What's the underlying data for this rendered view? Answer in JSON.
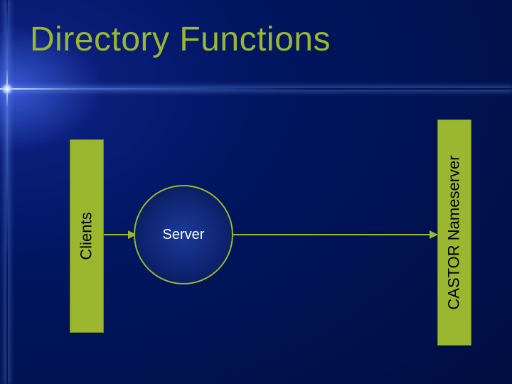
{
  "slide": {
    "title": "Directory Functions",
    "clients_label": "Clients",
    "server_label": "Server",
    "nameserver_label": "CASTOR Nameserver"
  }
}
